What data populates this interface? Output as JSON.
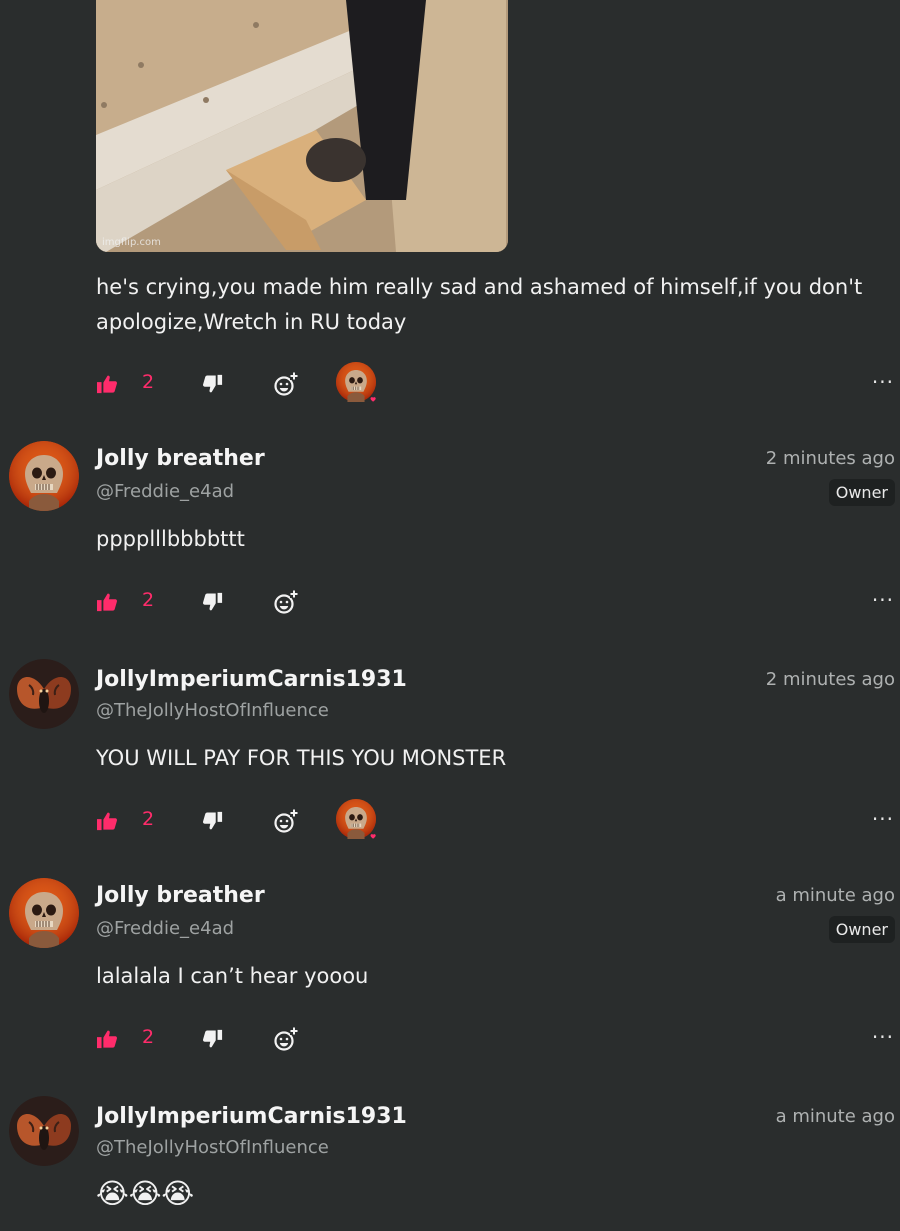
{
  "gif": {
    "watermark": "imgflip.com"
  },
  "comments": [
    {
      "text_lines": [
        "he's crying,you made him really sad and ashamed of himself,if you don't",
        "apologize,Wretch in RU today"
      ],
      "likes": "2"
    },
    {
      "username": "Jolly breather",
      "handle": "@Freddie_e4ad",
      "time": "2 minutes ago",
      "badge": "Owner",
      "text": "pppplllbbbbttt",
      "likes": "2"
    },
    {
      "username": "JollyImperiumCarnis1931",
      "handle": "@TheJollyHostOfInfluence",
      "time": "2 minutes ago",
      "text": "YOU WILL PAY FOR THIS YOU MONSTER",
      "likes": "2"
    },
    {
      "username": "Jolly breather",
      "handle": "@Freddie_e4ad",
      "time": "a minute ago",
      "badge": "Owner",
      "text": "lalalala I can’t hear yooou",
      "likes": "2"
    },
    {
      "username": "JollyImperiumCarnis1931",
      "handle": "@TheJollyHostOfInfluence",
      "time": "a minute ago",
      "text": "😭😭😭"
    }
  ],
  "icons": {
    "like": "thumbs-up-icon",
    "dislike": "thumbs-down-icon",
    "react": "add-reaction-icon",
    "more": "more-options-icon"
  },
  "colors": {
    "background": "#2a2d2d",
    "accent": "#ff2c6b",
    "muted": "#9ea2a2"
  }
}
